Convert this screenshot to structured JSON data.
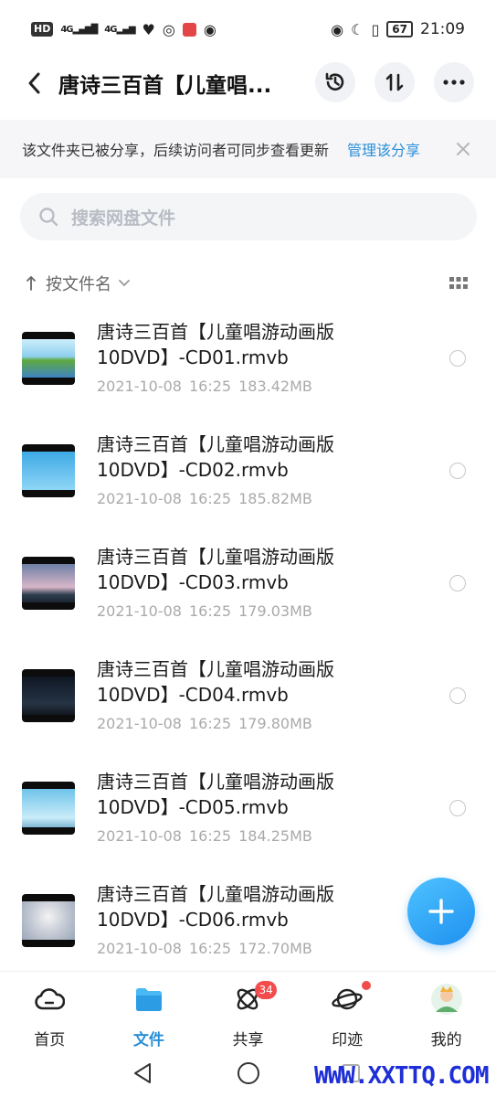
{
  "status_bar": {
    "left_tag": "HD",
    "left_tag_sub": "2",
    "sig1": "4G",
    "sig2": "4G",
    "battery": "67",
    "time": "21:09"
  },
  "header": {
    "title": "唐诗三百首【儿童唱...",
    "back_icon": "chevron-left-icon",
    "history_icon": "history-icon",
    "sort_icon": "transfer-icon",
    "more_icon": "more-icon"
  },
  "share_banner": {
    "text": "该文件夹已被分享，后续访问者可同步查看更新",
    "link": "管理该分享"
  },
  "search": {
    "placeholder": "搜索网盘文件"
  },
  "sort": {
    "label": "按文件名"
  },
  "files": [
    {
      "name": "唐诗三百首【儿童唱游动画版10DVD】-CD01.rmvb",
      "date": "2021-10-08",
      "time": "16:25",
      "size": "183.42MB",
      "thumb_color": "#7fc6e8"
    },
    {
      "name": "唐诗三百首【儿童唱游动画版10DVD】-CD02.rmvb",
      "date": "2021-10-08",
      "time": "16:25",
      "size": "185.82MB",
      "thumb_color": "#5ab8ec"
    },
    {
      "name": "唐诗三百首【儿童唱游动画版10DVD】-CD03.rmvb",
      "date": "2021-10-08",
      "time": "16:25",
      "size": "179.03MB",
      "thumb_color": "#a9a2c2"
    },
    {
      "name": "唐诗三百首【儿童唱游动画版10DVD】-CD04.rmvb",
      "date": "2021-10-08",
      "time": "16:25",
      "size": "179.80MB",
      "thumb_color": "#1b2430"
    },
    {
      "name": "唐诗三百首【儿童唱游动画版10DVD】-CD05.rmvb",
      "date": "2021-10-08",
      "time": "16:25",
      "size": "184.25MB",
      "thumb_color": "#9fd8f2"
    },
    {
      "name": "唐诗三百首【儿童唱游动画版10DVD】-CD06.rmvb",
      "date": "2021-10-08",
      "time": "16:25",
      "size": "172.70MB",
      "thumb_color": "#d8dde3"
    }
  ],
  "bottom_nav": [
    {
      "label": "首页",
      "icon": "cloud-icon"
    },
    {
      "label": "文件",
      "icon": "folder-icon",
      "active": true
    },
    {
      "label": "共享",
      "icon": "atom-icon",
      "badge": "34"
    },
    {
      "label": "印迹",
      "icon": "planet-icon",
      "dot": true
    },
    {
      "label": "我的",
      "icon": "avatar-icon"
    }
  ],
  "watermark": "WWW.XXTTQ.COM",
  "colors": {
    "accent": "#2a8fd8",
    "badge": "#f24c4c"
  }
}
